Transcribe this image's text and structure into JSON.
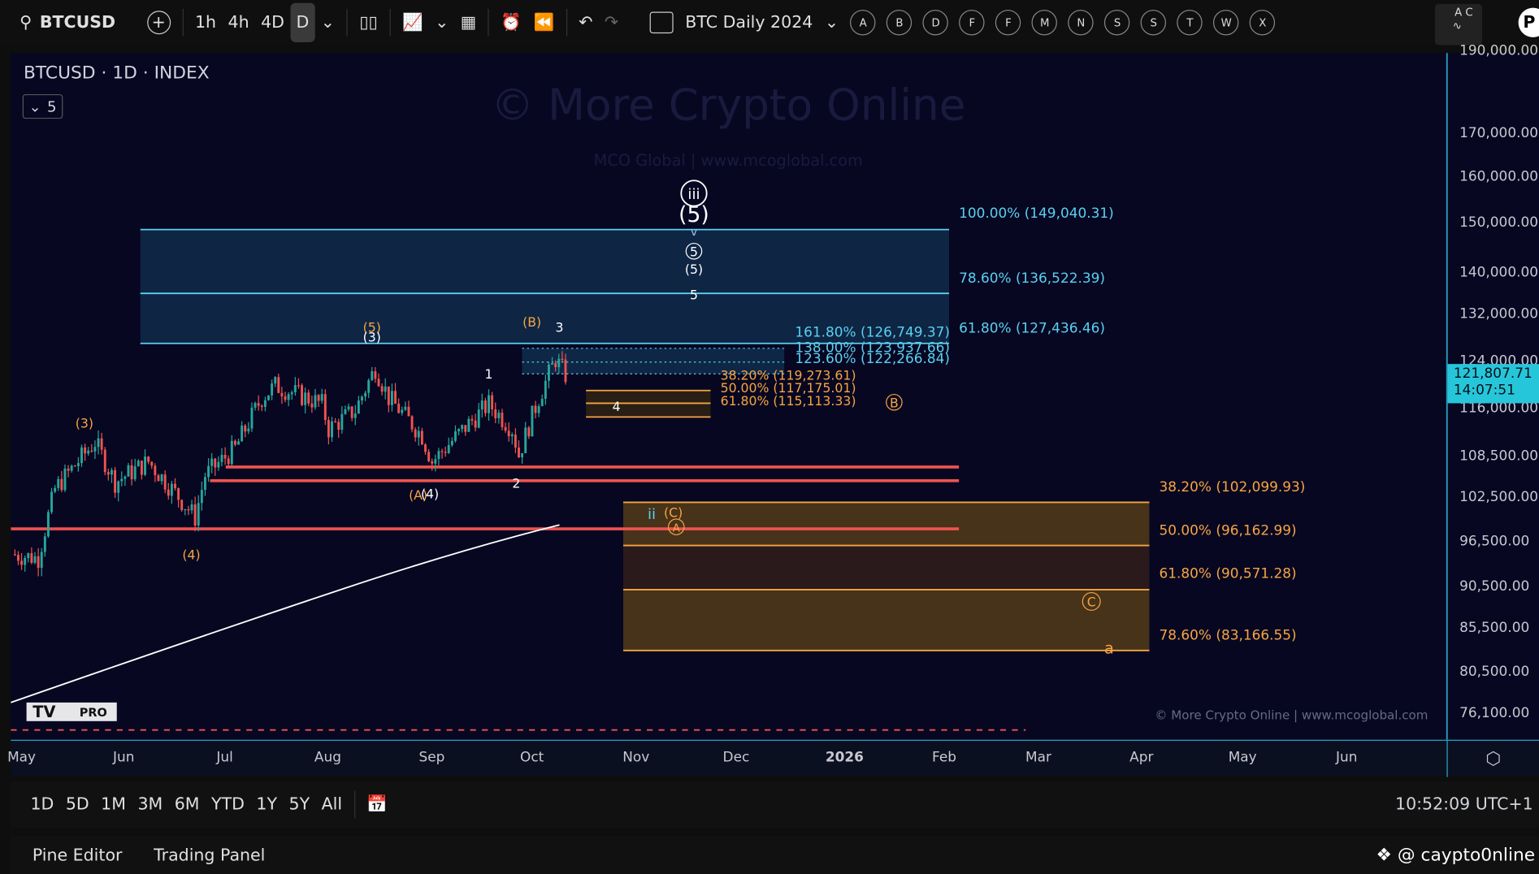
{
  "toolbar": {
    "symbol": "BTCUSD",
    "intervals": [
      "1h",
      "4h",
      "4D",
      "D"
    ],
    "active_interval": "D",
    "layout_name": "BTC Daily 2024",
    "favorites": [
      "A",
      "B",
      "D",
      "F",
      "F",
      "M",
      "N",
      "S",
      "S",
      "T",
      "W",
      "X"
    ],
    "watermark_badge": "A C",
    "profile_letter": "P"
  },
  "legend": {
    "title": "BTCUSD · 1D · INDEX",
    "collapse_count": "5"
  },
  "watermark": {
    "title": "© More Crypto Online",
    "subtitle": "MCO Global  |  www.mcoglobal.com",
    "footer": "© More Crypto Online  |  www.mcoglobal.com"
  },
  "price_axis": {
    "ticks": [
      "170,000.00",
      "160,000.00",
      "150,000.00",
      "140,000.00",
      "132,000.00",
      "124,000.00",
      "116,000.00",
      "108,500.00",
      "102,500.00",
      "96,500.00",
      "90,500.00",
      "85,500.00",
      "80,500.00",
      "76,100.00"
    ],
    "top_tick": "190,000.00",
    "current_price": "121,807.71",
    "countdown": "14:07:51"
  },
  "time_axis": [
    "May",
    "Jun",
    "Jul",
    "Aug",
    "Sep",
    "Oct",
    "Nov",
    "Dec",
    "2026",
    "Feb",
    "Mar",
    "Apr",
    "May",
    "Jun"
  ],
  "fib_upper": [
    "100.00% (149,040.31)",
    "78.60% (136,522.39)",
    "61.80% (127,436.46)"
  ],
  "fib_ext": [
    "161.80% (126,749.37)",
    "138.00% (123,937.66)",
    "123.60% (122,266.84)"
  ],
  "fib_small": [
    "38.20% (119,273.61)",
    "50.00% (117,175.01)",
    "61.80% (115,113.33)"
  ],
  "fib_lower": [
    "38.20% (102,099.93)",
    "50.00% (96,162.99)",
    "61.80% (90,571.28)",
    "78.60% (83,166.55)"
  ],
  "wave_labels": {
    "iii": "iii",
    "p5_big": "(5)",
    "v": "v",
    "c5": "5",
    "p5": "(5)",
    "w5": "5",
    "B_paren": "(B)",
    "w3": "3",
    "w1": "1",
    "w4": "4",
    "Bc": "B",
    "p5o": "(5)",
    "p3": "(3)",
    "p3o": "(3)",
    "p4": "(4)",
    "A4a": "(A)",
    "A4b": "(4)",
    "w2": "2",
    "ii": "ii",
    "Cp": "(C)",
    "Ac": "A",
    "Cc": "C",
    "a": "a"
  },
  "range_buttons": [
    "1D",
    "5D",
    "1M",
    "3M",
    "6M",
    "YTD",
    "1Y",
    "5Y",
    "All"
  ],
  "clock": "10:52:09 UTC+1",
  "panel": {
    "tabs": [
      "Pine Editor",
      "Trading Panel"
    ],
    "handle": "@ caypto0nline"
  },
  "logo": {
    "text": "TV PRO"
  },
  "colors": {
    "up": "#26a69a",
    "down": "#ef5350",
    "fib_blue": "#5bd0f0",
    "fib_orange": "#f7a541",
    "bg": "#070722"
  },
  "price_path": [
    [
      -3,
      95000
    ],
    [
      5,
      94500
    ],
    [
      10,
      104000
    ],
    [
      22,
      111000
    ],
    [
      28,
      105000
    ],
    [
      38,
      108000
    ],
    [
      52,
      100000
    ],
    [
      55,
      106000
    ],
    [
      64,
      110000
    ],
    [
      72,
      118000
    ],
    [
      76,
      120000
    ],
    [
      90,
      117000
    ],
    [
      92,
      113000
    ],
    [
      100,
      116000
    ],
    [
      106,
      123000
    ],
    [
      110,
      118000
    ],
    [
      120,
      112000
    ],
    [
      123,
      108000
    ],
    [
      140,
      117000
    ],
    [
      147,
      113000
    ],
    [
      149,
      109000
    ],
    [
      155,
      118000
    ],
    [
      160,
      124500
    ],
    [
      163,
      121800
    ]
  ]
}
